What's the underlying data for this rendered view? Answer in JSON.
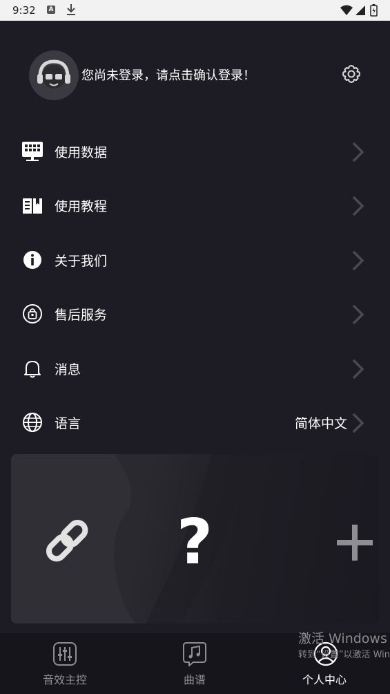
{
  "status_bar": {
    "time": "9:32",
    "icons": [
      "accessibility-a-icon",
      "download-icon",
      "wifi-icon",
      "signal-icon",
      "battery-icon"
    ]
  },
  "profile": {
    "login_prompt": "您尚未登录，请点击确认登录！",
    "avatar_icon": "avatar-headphones-icon",
    "settings_icon": "gear-icon"
  },
  "menu": {
    "items": [
      {
        "label": "使用数据",
        "icon": "data-chart-icon"
      },
      {
        "label": "使用教程",
        "icon": "book-icon"
      },
      {
        "label": "关于我们",
        "icon": "info-icon"
      },
      {
        "label": "售后服务",
        "icon": "service-bag-icon"
      },
      {
        "label": "消息",
        "icon": "bell-icon"
      },
      {
        "label": "语言",
        "icon": "globe-icon",
        "value": "简体中文"
      }
    ]
  },
  "card": {
    "icons": [
      "link-icon",
      "question-icon",
      "plus-icon"
    ],
    "question_mark": "?"
  },
  "tabbar": {
    "tabs": [
      {
        "label": "音效主控",
        "icon": "mixer-icon",
        "active": false
      },
      {
        "label": "曲谱",
        "icon": "music-note-icon",
        "active": false
      },
      {
        "label": "个人中心",
        "icon": "person-icon",
        "active": true
      }
    ]
  },
  "watermark": {
    "line1": "激活 Windows",
    "line2": "转到“设置”以激活 Windows。"
  },
  "colors": {
    "background": "#1d1c24",
    "tabbar": "#16151b",
    "card": "#2a2930",
    "inactive": "#8e8d94",
    "chevron": "#4a4950"
  }
}
